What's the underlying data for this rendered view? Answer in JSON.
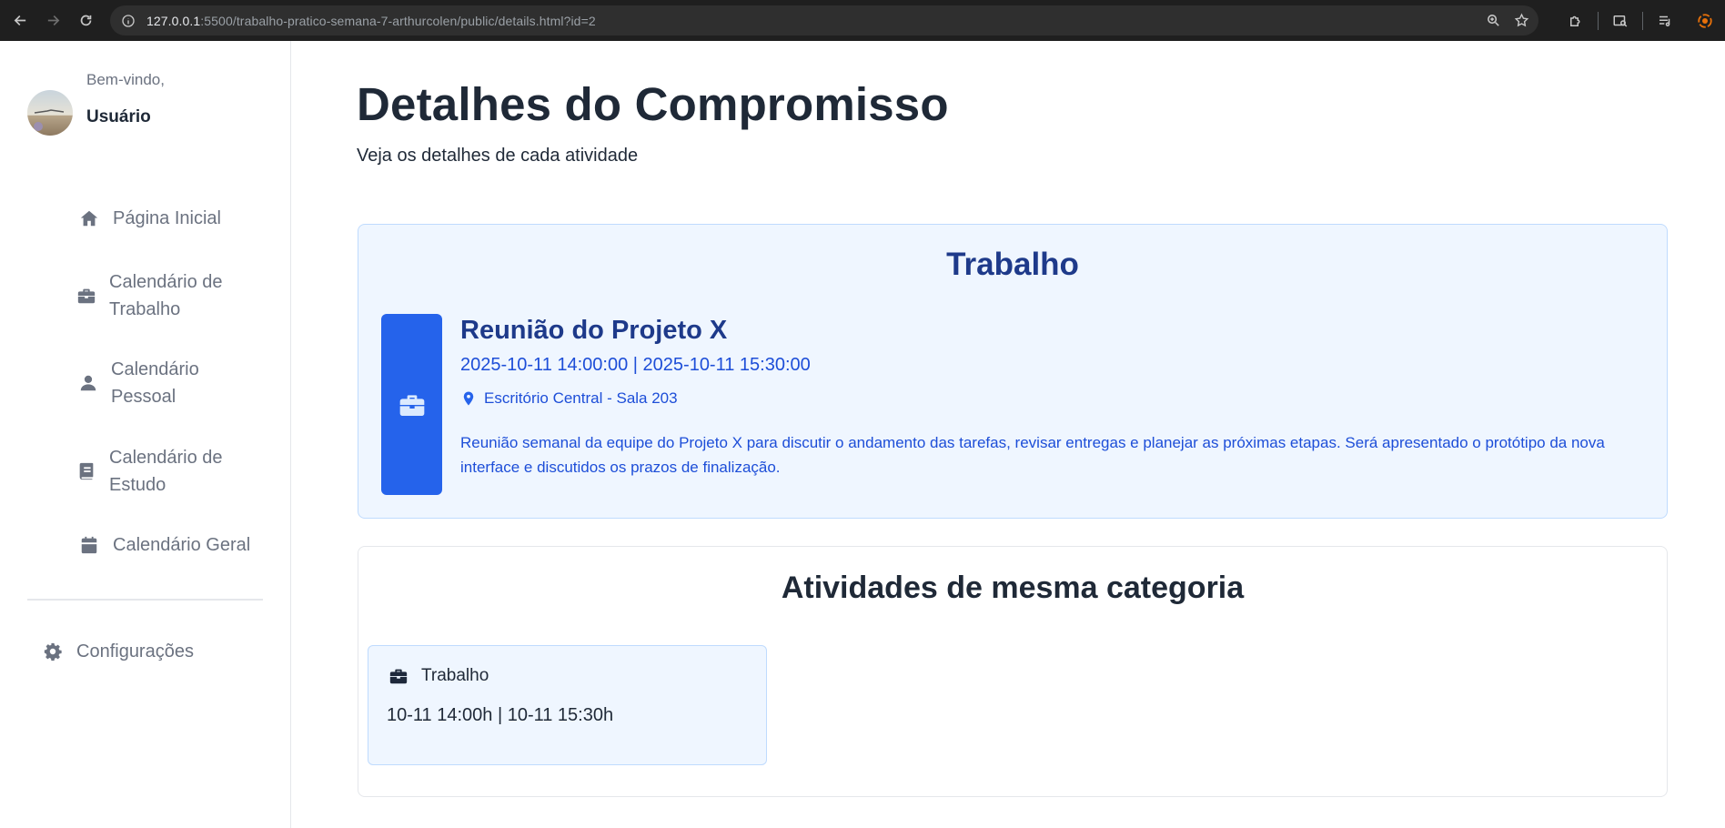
{
  "browser": {
    "url_host": "127.0.0.1",
    "url_rest": ":5500/trabalho-pratico-semana-7-arthurcolen/public/details.html?id=2"
  },
  "sidebar": {
    "greeting": "Bem-vindo,",
    "username": "Usuário",
    "items": [
      {
        "label": "Página Inicial",
        "icon": "home-icon"
      },
      {
        "label": "Calendário de Trabalho",
        "icon": "briefcase-icon"
      },
      {
        "label": "Calendário Pessoal",
        "icon": "user-icon"
      },
      {
        "label": "Calendário de Estudo",
        "icon": "book-icon"
      },
      {
        "label": "Calendário Geral",
        "icon": "calendar-icon"
      }
    ],
    "settings_label": "Configurações"
  },
  "header": {
    "title": "Detalhes do Compromisso",
    "subtitle": "Veja os detalhes de cada atividade"
  },
  "detail": {
    "category": "Trabalho",
    "title": "Reunião do Projeto X",
    "time": "2025-10-11 14:00:00 | 2025-10-11 15:30:00",
    "location": "Escritório Central - Sala 203",
    "description": "Reunião semanal da equipe do Projeto X para discutir o andamento das tarefas, revisar entregas e planejar as próximas etapas. Será apresentado o protótipo da nova interface e discutidos os prazos de finalização."
  },
  "related": {
    "title": "Atividades de mesma categoria",
    "items": [
      {
        "category": "Trabalho",
        "time": "10-11 14:00h | 10-11 15:30h"
      }
    ]
  },
  "colors": {
    "accent": "#2563eb",
    "card_bg": "#eff6ff",
    "heading_blue": "#1e3a8a"
  }
}
